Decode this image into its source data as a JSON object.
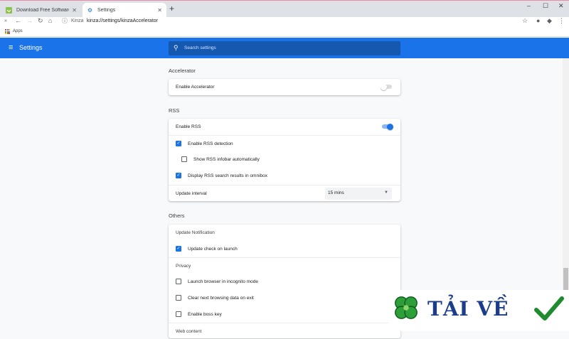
{
  "tabs": [
    {
      "title": "Download Free Software for Wind",
      "active": false
    },
    {
      "title": "Settings",
      "active": true
    }
  ],
  "toolbar": {
    "site_label": "Kinza",
    "url": "kinza://settings/kinzaAccelerator"
  },
  "bookmarks": {
    "apps_label": "Apps"
  },
  "header": {
    "title": "Settings",
    "search_placeholder": "Search settings"
  },
  "sections": {
    "accelerator": {
      "title": "Accelerator",
      "enable_label": "Enable Accelerator",
      "enabled": false
    },
    "rss": {
      "title": "RSS",
      "enable_label": "Enable RSS",
      "enabled": true,
      "detection_label": "Enable RSS detection",
      "detection_checked": true,
      "infobar_label": "Show RSS infobar automatically",
      "infobar_checked": false,
      "omnibox_label": "Display RSS search results in omnibox",
      "omnibox_checked": true,
      "interval_label": "Update interval",
      "interval_value": "15 mins"
    },
    "others": {
      "title": "Others",
      "update_heading": "Update Notification",
      "update_check_label": "Update check on launch",
      "update_check_checked": true,
      "privacy_heading": "Privacy",
      "incognito_label": "Launch browser in incognito mode",
      "incognito_checked": false,
      "clear_label": "Clear next browsing data on exit",
      "clear_checked": false,
      "boss_label": "Enable boss key",
      "boss_checked": false,
      "web_content_heading": "Web content"
    }
  },
  "watermark": {
    "text": "TẢI VỀ"
  },
  "colors": {
    "accent": "#1a73e8",
    "header": "#1a73e8",
    "watermark": "#1a3c8a"
  }
}
